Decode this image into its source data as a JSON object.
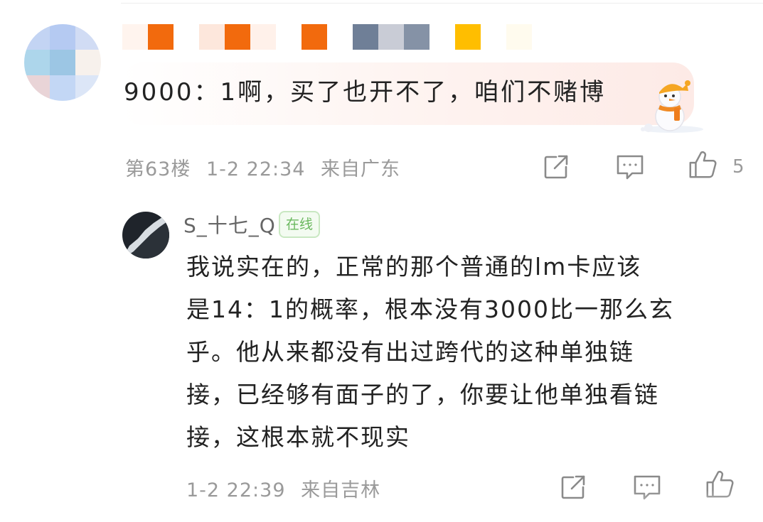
{
  "comment": {
    "text": "9000：1啊，买了也开不了，咱们不赌博",
    "floor": "第63楼",
    "time": "1-2 22:34",
    "location": "来自广东",
    "like_count": "5"
  },
  "reply": {
    "username": "S_十七_Q",
    "badge": "在线",
    "lines": [
      "我说实在的，正常的那个普通的lm卡应该",
      "是14：1的概率，根本没有3000比一那么玄",
      "乎。他从来都没有出过跨代的这种单独链",
      "接，已经够有面子的了，你要让他单独看链",
      "接，这根本就不现实"
    ],
    "time": "1-2 22:39",
    "location": "来自吉林"
  },
  "colors": {
    "meta_text": "#9a9a9a",
    "badge_green": "#6bb85f",
    "bubble_pink": "#fdeae6"
  },
  "icons": [
    "share-icon",
    "comment-icon",
    "thumbs-up-icon"
  ]
}
